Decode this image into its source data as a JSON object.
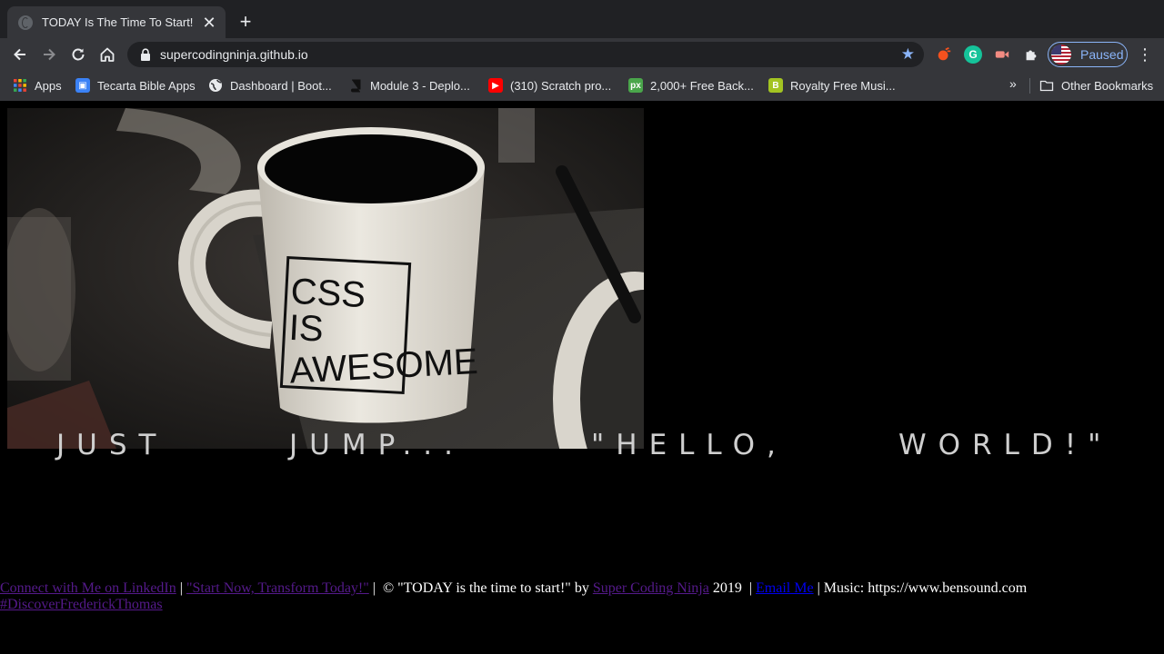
{
  "browser": {
    "tab": {
      "title": "TODAY Is The Time To Start!",
      "close": "✕"
    },
    "new_tab": "+",
    "url": "supercodingninja.github.io",
    "profile": {
      "label": "Paused"
    },
    "extensions": [
      "ext-orange-icon",
      "grammarly-icon",
      "screencast-icon",
      "puzzle-icon"
    ],
    "bookmarks": [
      {
        "label": "Apps",
        "icon": "apps-grid-icon"
      },
      {
        "label": "Tecarta Bible Apps",
        "icon": "bible-icon"
      },
      {
        "label": "Dashboard | Boot...",
        "icon": "globe-icon"
      },
      {
        "label": "Module 3 - Deplo...",
        "icon": "book-icon"
      },
      {
        "label": "(310) Scratch pro...",
        "icon": "youtube-icon"
      },
      {
        "label": "2,000+ Free Back...",
        "icon": "px-icon"
      },
      {
        "label": "Royalty Free Musi...",
        "icon": "b-icon"
      }
    ],
    "bookmarks_overflow": "»",
    "other_bookmarks": "Other Bookmarks"
  },
  "page": {
    "hero_mug_text": [
      "CSS",
      "IS",
      "AWESOME"
    ],
    "tagline": [
      "JUST",
      "JUMP...",
      "\"HELLO,",
      "WORLD!\""
    ],
    "footer": {
      "linkedin": "Connect with Me on LinkedIn",
      "sep1": " | ",
      "start_now": "\"Start Now, Transform Today!\"",
      "sep2": " | ",
      "copyright_prefix": " © \"TODAY is the time to start!\" by ",
      "author": "Super Coding Ninja",
      "year": " 2019 ",
      "sep3": " | ",
      "email": "Email Me",
      "music": " | Music: https://www.bensound.com",
      "hashtag": "#DiscoverFrederickThomas"
    }
  },
  "colors": {
    "tabstrip_bg": "#202124",
    "toolbar_bg": "#35363a",
    "page_bg": "#000000",
    "visited_link": "#551a8b",
    "link": "#0000ee",
    "accent": "#8ab4f8"
  }
}
